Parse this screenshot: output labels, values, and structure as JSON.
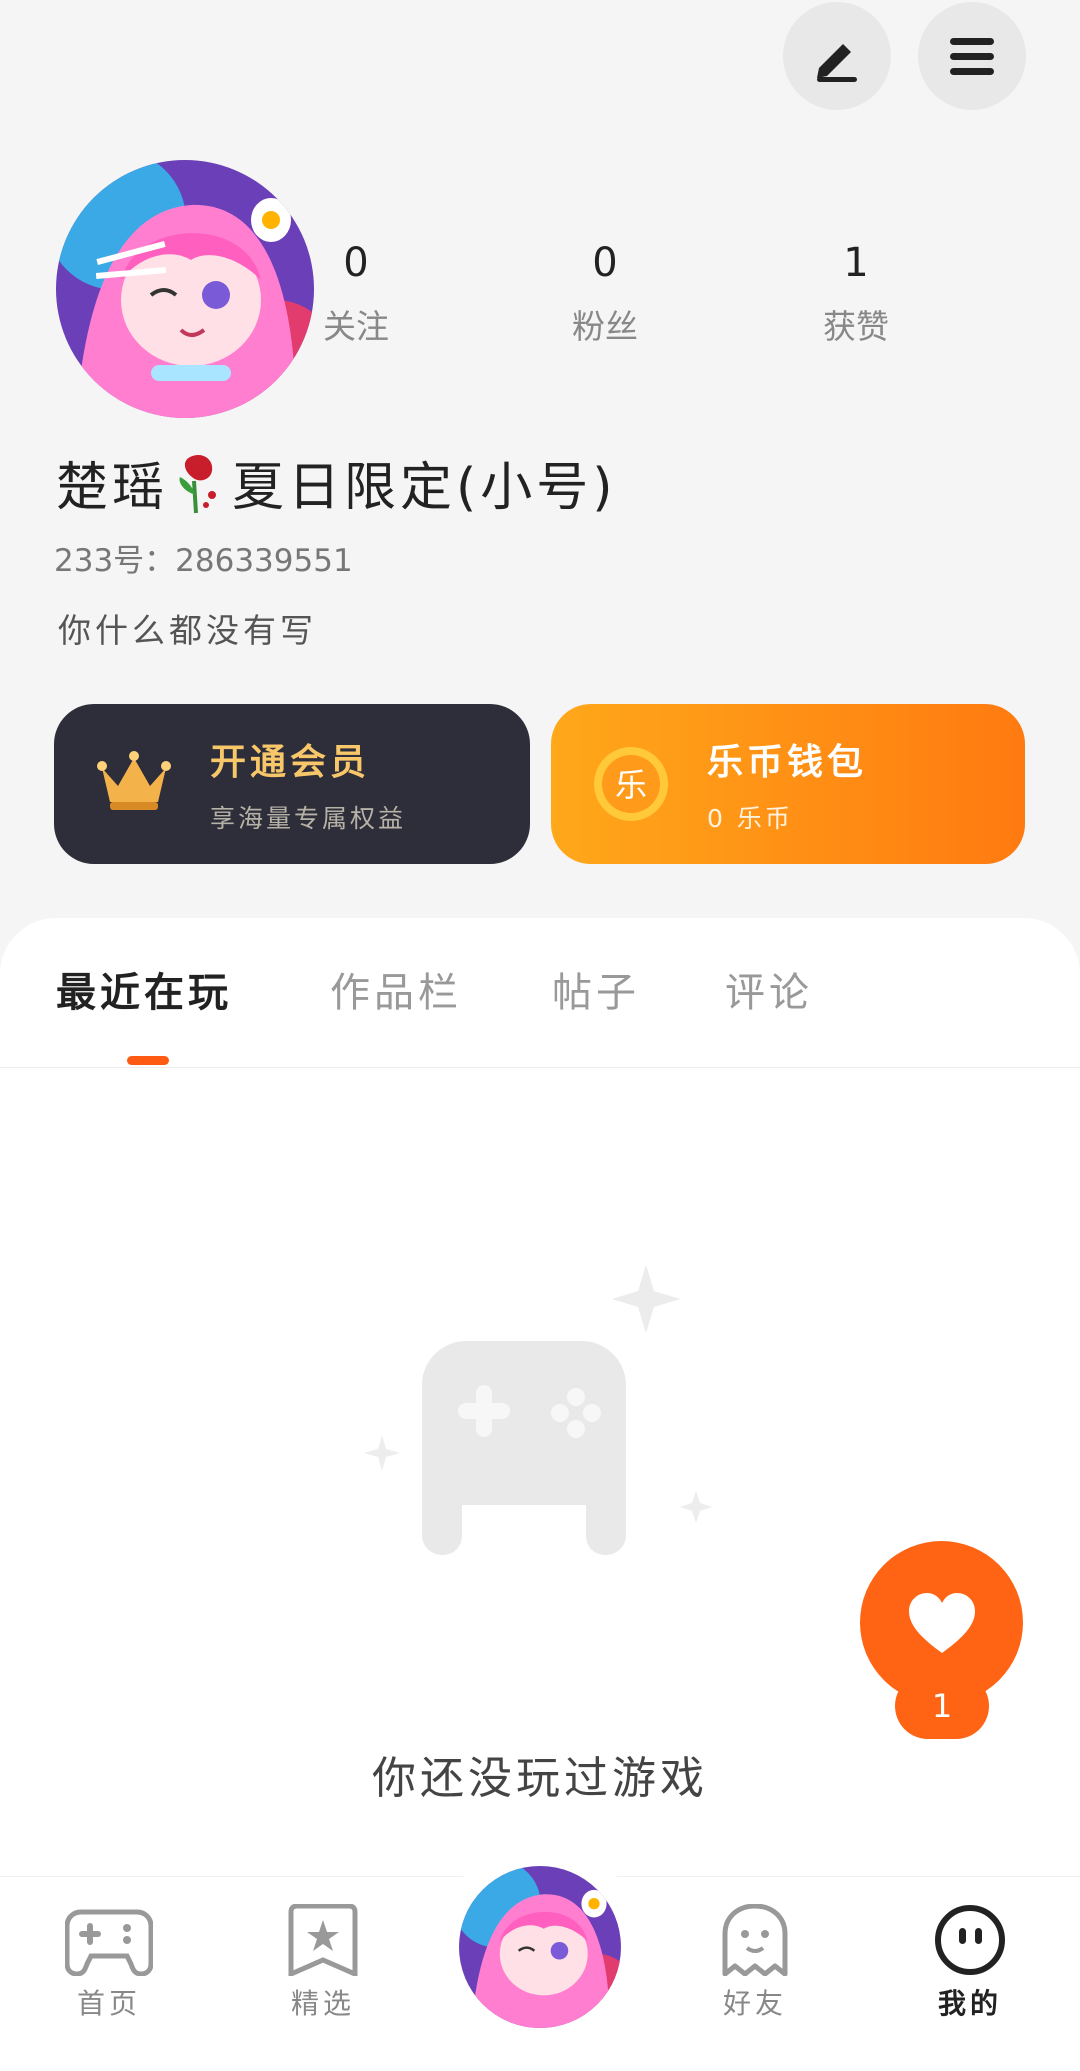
{
  "profile": {
    "nickname_part1": "楚瑶",
    "nickname_part2": "夏日限定(小号)",
    "uid": "233号：286339551",
    "bio": "你什么都没有写"
  },
  "stats": [
    {
      "value": "0",
      "label": "关注"
    },
    {
      "value": "0",
      "label": "粉丝"
    },
    {
      "value": "1",
      "label": "获赞"
    }
  ],
  "cards": {
    "vip": {
      "title": "开通会员",
      "subtitle": "享海量专属权益"
    },
    "wallet": {
      "title": "乐币钱包",
      "subtitle": "0 乐币",
      "coin_char": "乐"
    }
  },
  "tabs": [
    {
      "label": "最近在玩",
      "active": true
    },
    {
      "label": "作品栏",
      "active": false
    },
    {
      "label": "帖子",
      "active": false
    },
    {
      "label": "评论",
      "active": false
    }
  ],
  "empty_state": {
    "message": "你还没玩过游戏"
  },
  "fab": {
    "like_count": "1"
  },
  "bottom_nav": [
    {
      "label": "首页",
      "icon": "gamepad-icon"
    },
    {
      "label": "精选",
      "icon": "star-bookmark-icon"
    },
    {
      "label": "",
      "icon": "avatar"
    },
    {
      "label": "好友",
      "icon": "ghost-icon"
    },
    {
      "label": "我的",
      "icon": "face-icon",
      "active": true
    }
  ],
  "colors": {
    "accent": "#ff6414",
    "vip_bg": "#2e2d3a",
    "vip_gold": "#f7c76a",
    "wallet_start": "#ffa81a",
    "wallet_end": "#ff7a10"
  }
}
